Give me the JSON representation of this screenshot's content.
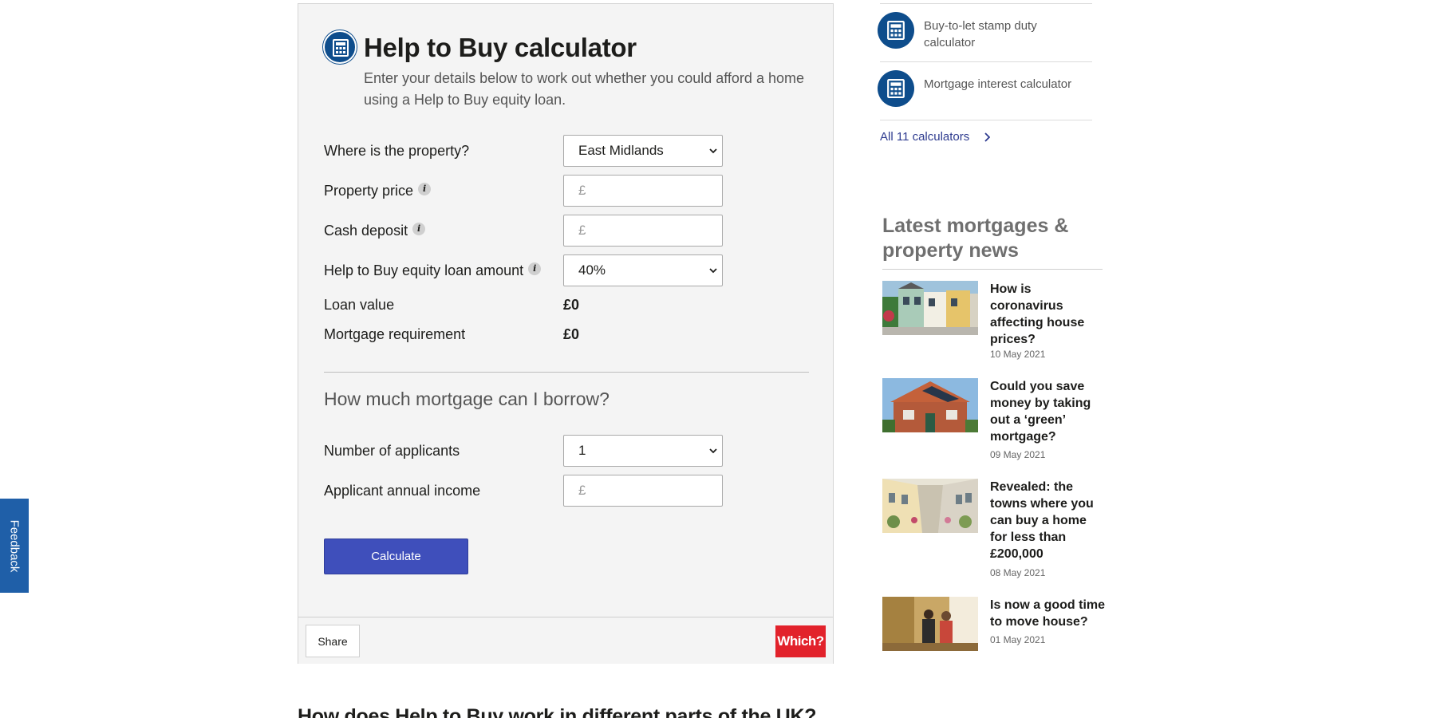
{
  "calculator": {
    "title": "Help to Buy calculator",
    "intro": "Enter your details below to work out whether you could afford a home using a Help to Buy equity loan.",
    "icon": "calculator-icon",
    "fields": {
      "region_label": "Where is the property?",
      "region_value": "East Midlands",
      "price_label": "Property price",
      "price_placeholder": "£",
      "deposit_label": "Cash deposit",
      "deposit_placeholder": "£",
      "equity_label": "Help to Buy equity loan amount",
      "equity_value": "40%",
      "loan_label": "Loan value",
      "loan_value": "£0",
      "mortgage_label": "Mortgage requirement",
      "mortgage_value": "£0",
      "applicants_label": "Number of applicants",
      "applicants_value": "1",
      "income_label": "Applicant annual income",
      "income_placeholder": "£"
    },
    "info_glyph": "i",
    "borrow_heading": "How much mortgage can I borrow?",
    "calculate_label": "Calculate",
    "share_label": "Share",
    "logo_text": "Which?"
  },
  "bottom_heading": "How does Help to Buy work in different parts of the UK?",
  "sidebar": {
    "calculators": [
      {
        "label": "Buy-to-let stamp duty calculator",
        "icon": "calculator-icon"
      },
      {
        "label": "Mortgage interest calculator",
        "icon": "calculator-icon"
      }
    ],
    "all_link": "All 11 calculators",
    "news_heading": "Latest mortgages & property news",
    "news": [
      {
        "title": "How is coronavirus affecting house prices?",
        "date": "10 May 2021"
      },
      {
        "title": "Could you save money by taking out a ‘green’ mortgage?",
        "date": "09 May 2021"
      },
      {
        "title": "Revealed: the towns where you can buy a home for less than £200,000",
        "date": "08 May 2021"
      },
      {
        "title": "Is now a good time to move house?",
        "date": "01 May 2021"
      }
    ]
  },
  "feedback_label": "Feedback",
  "colors": {
    "primary_blue": "#0e4d8c",
    "button_blue": "#3f4fbb",
    "which_red": "#e2222b",
    "panel_bg": "#f4f4f4"
  }
}
